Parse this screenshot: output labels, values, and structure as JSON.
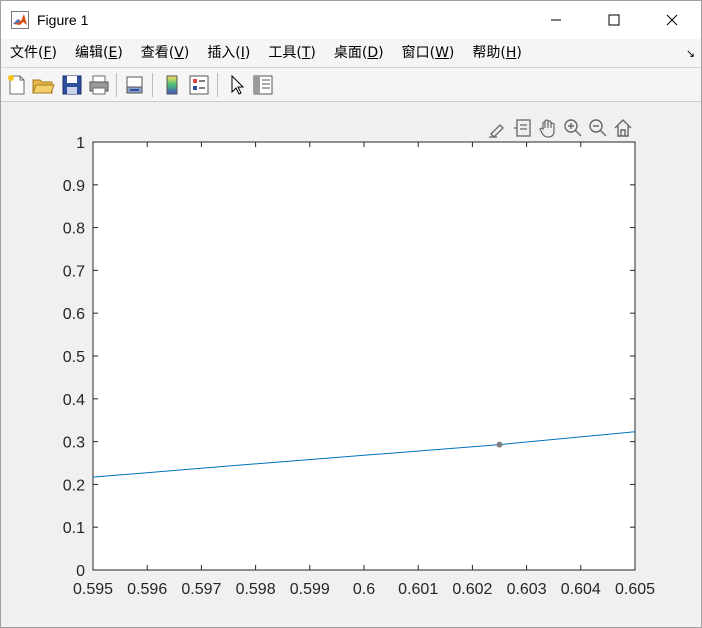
{
  "window": {
    "title": "Figure 1",
    "app_icon": "matlab-icon",
    "controls": [
      "minimize-icon",
      "maximize-icon",
      "close-icon"
    ]
  },
  "menubar": {
    "items": [
      {
        "label": "文件(",
        "key": "F",
        "end": ")"
      },
      {
        "label": "编辑(",
        "key": "E",
        "end": ")"
      },
      {
        "label": "查看(",
        "key": "V",
        "end": ")"
      },
      {
        "label": "插入(",
        "key": "I",
        "end": ")"
      },
      {
        "label": "工具(",
        "key": "T",
        "end": ")"
      },
      {
        "label": "桌面(",
        "key": "D",
        "end": ")"
      },
      {
        "label": "窗口(",
        "key": "W",
        "end": ")"
      },
      {
        "label": "帮助(",
        "key": "H",
        "end": ")"
      }
    ]
  },
  "toolbar": {
    "buttons": [
      "new-figure-icon",
      "open-file-icon",
      "save-icon",
      "print-icon",
      "link-plot-icon",
      "insert-colorbar-icon",
      "insert-legend-icon",
      "edit-plot-icon",
      "property-inspector-icon"
    ]
  },
  "axes_toolbar": {
    "buttons": [
      "brush-icon",
      "data-tips-icon",
      "pan-icon",
      "zoom-in-icon",
      "zoom-out-icon",
      "home-icon"
    ]
  },
  "colors": {
    "line": "#0072bd",
    "marker": "#808080",
    "axes_bg": "#ffffff",
    "figure_bg": "#f0f0f0"
  },
  "chart_data": {
    "type": "line",
    "title": "",
    "xlabel": "",
    "ylabel": "",
    "xlim": [
      0.595,
      0.605
    ],
    "ylim": [
      0,
      1
    ],
    "xticks": [
      "0.595",
      "0.596",
      "0.597",
      "0.598",
      "0.599",
      "0.6",
      "0.601",
      "0.602",
      "0.603",
      "0.604",
      "0.605"
    ],
    "yticks": [
      "0",
      "0.1",
      "0.2",
      "0.3",
      "0.4",
      "0.5",
      "0.6",
      "0.7",
      "0.8",
      "0.9",
      "1"
    ],
    "grid": false,
    "series": [
      {
        "x": [
          0.595,
          0.5975,
          0.6,
          0.6025,
          0.605
        ],
        "y": [
          0.217,
          0.243,
          0.268,
          0.293,
          0.323
        ]
      }
    ],
    "markers": [
      {
        "x": 0.6025,
        "y": 0.293
      }
    ]
  }
}
